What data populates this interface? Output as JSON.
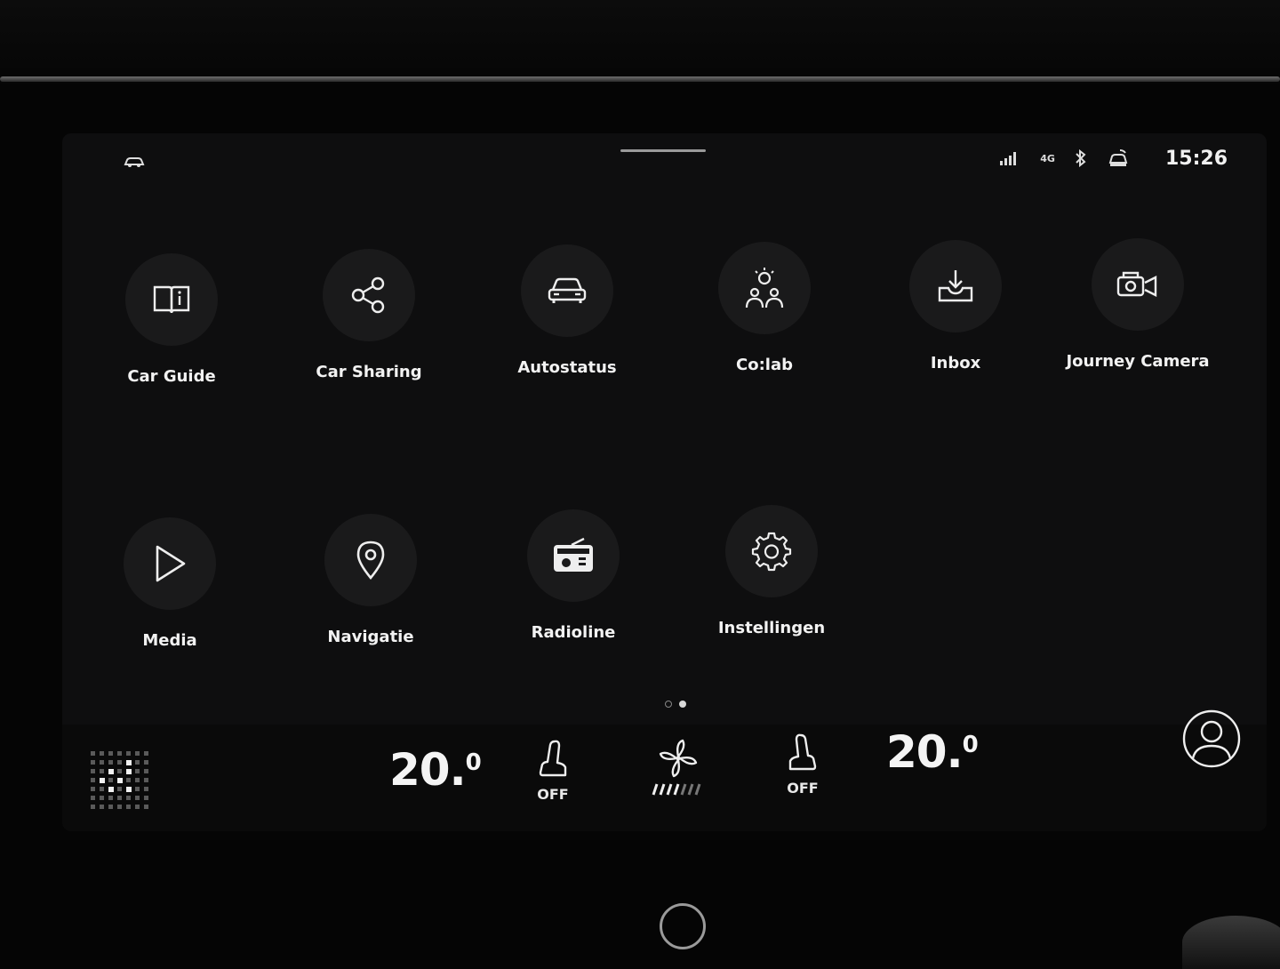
{
  "status": {
    "time": "15:26",
    "network": "4G"
  },
  "apps": [
    {
      "label": "Car Guide",
      "icon": "book-info-icon"
    },
    {
      "label": "Car Sharing",
      "icon": "share-icon"
    },
    {
      "label": "Autostatus",
      "icon": "car-icon"
    },
    {
      "label": "Co:lab",
      "icon": "community-icon"
    },
    {
      "label": "Inbox",
      "icon": "inbox-icon"
    },
    {
      "label": "Journey Camera",
      "icon": "camera-icon"
    },
    {
      "label": "Media",
      "icon": "play-icon"
    },
    {
      "label": "Navigatie",
      "icon": "location-pin-icon"
    },
    {
      "label": "Radioline",
      "icon": "radio-icon"
    },
    {
      "label": "Instellingen",
      "icon": "gear-icon"
    }
  ],
  "pager": {
    "pages": 2,
    "active": 2
  },
  "climate": {
    "left_temp": "20.",
    "left_unit": "0",
    "right_temp": "20.",
    "right_unit": "0",
    "left_seat": "OFF",
    "right_seat": "OFF"
  }
}
